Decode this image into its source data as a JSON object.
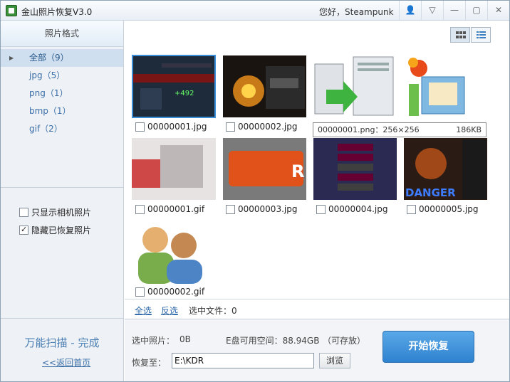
{
  "window": {
    "title": "金山照片恢复V3.0",
    "greeting": "您好，Steampunk"
  },
  "titlebar_buttons": [
    {
      "icon": "user-icon",
      "glyph": "👤"
    },
    {
      "icon": "menu-icon",
      "glyph": "▽"
    },
    {
      "icon": "minimize-icon",
      "glyph": "—"
    },
    {
      "icon": "maximize-icon",
      "glyph": "▢"
    },
    {
      "icon": "close-icon",
      "glyph": "✕"
    }
  ],
  "sidebar": {
    "header": "照片格式",
    "categories": [
      {
        "label": "全部（9）",
        "selected": true
      },
      {
        "label": "jpg（5）",
        "selected": false
      },
      {
        "label": "png（1）",
        "selected": false
      },
      {
        "label": "bmp（1）",
        "selected": false
      },
      {
        "label": "gif（2）",
        "selected": false
      }
    ],
    "options": [
      {
        "label": "只显示相机照片",
        "checked": false
      },
      {
        "label": "隐藏已恢复照片",
        "checked": true
      }
    ],
    "scan_status": "万能扫描 - 完成",
    "back_link": "<<返回首页"
  },
  "files": [
    {
      "name": "00000001.jpg",
      "selected": true
    },
    {
      "name": "00000002.jpg",
      "selected": false
    },
    {
      "name": "00000001.png",
      "selected": false
    },
    {
      "name": "",
      "selected": false
    },
    {
      "name": "00000001.gif",
      "selected": false
    },
    {
      "name": "00000003.jpg",
      "selected": false
    },
    {
      "name": "00000004.jpg",
      "selected": false
    },
    {
      "name": "00000005.jpg",
      "selected": false
    },
    {
      "name": "00000002.gif",
      "selected": false
    }
  ],
  "tooltip": {
    "name": "00000001.png：256×256",
    "size": "186KB"
  },
  "selection_bar": {
    "select_all": "全选",
    "invert": "反选",
    "selected_count": "选中文件：0"
  },
  "bottom": {
    "selected_label": "选中照片：",
    "selected_value": "0B",
    "disk_label": "E盘可用空间：88.94GB",
    "storable": "（可存放）",
    "restore_to_label": "恢复至：",
    "path": "E:\\KDR",
    "browse": "浏览",
    "start": "开始恢复"
  },
  "colors": {
    "accent": "#3b8fd8",
    "link": "#2a66a8",
    "start_button": "#3d90d8"
  }
}
